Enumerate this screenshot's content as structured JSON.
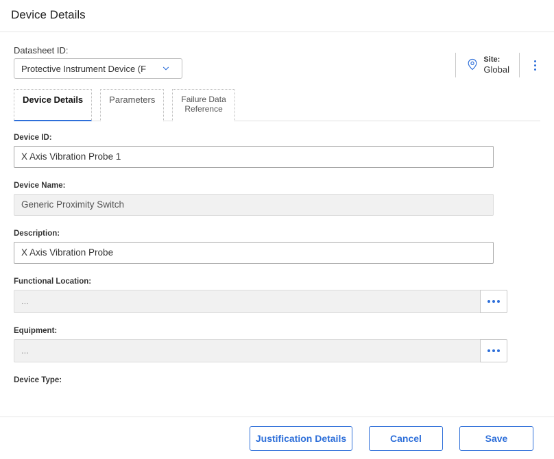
{
  "header": {
    "title": "Device Details"
  },
  "datasheet": {
    "label": "Datasheet ID:",
    "selected": "Protective Instrument Device  (F"
  },
  "site": {
    "label": "Site:",
    "value": "Global"
  },
  "tabs": [
    {
      "label": "Device Details",
      "active": true
    },
    {
      "label": "Parameters",
      "active": false
    },
    {
      "label": "Failure Data\nReference",
      "active": false
    }
  ],
  "fields": {
    "device_id": {
      "label": "Device ID:",
      "value": "X Axis Vibration Probe 1"
    },
    "device_name": {
      "label": "Device Name:",
      "value": "Generic Proximity Switch"
    },
    "description": {
      "label": "Description:",
      "value": "X Axis Vibration Probe"
    },
    "functional_loc": {
      "label": "Functional Location:",
      "value": "..."
    },
    "equipment": {
      "label": "Equipment:",
      "value": "..."
    },
    "device_type": {
      "label": "Device Type:"
    }
  },
  "footer": {
    "justification": "Justification Details",
    "cancel": "Cancel",
    "save": "Save"
  }
}
